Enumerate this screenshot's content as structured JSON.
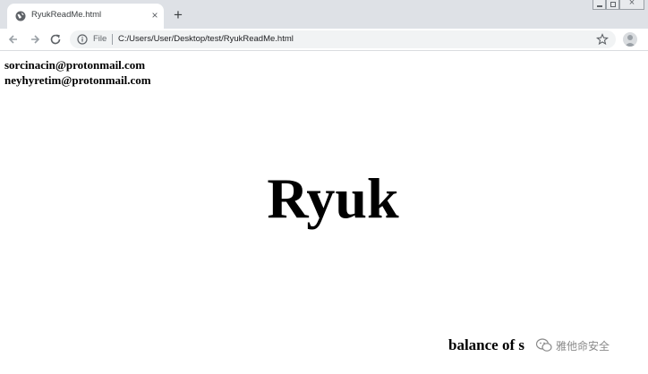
{
  "browser": {
    "tab": {
      "title": "RyukReadMe.html",
      "close_glyph": "×",
      "favicon": "globe-icon"
    },
    "new_tab_glyph": "+",
    "omnibox": {
      "scheme_label": "File",
      "url": "C:/Users/User/Desktop/test/RyukReadMe.html"
    },
    "icons": [
      "back-arrow-icon",
      "forward-arrow-icon",
      "reload-icon",
      "info-icon",
      "star-icon",
      "profile-avatar-icon"
    ]
  },
  "page": {
    "emails": [
      "sorcinacin@protonmail.com",
      "neyhyretim@protonmail.com"
    ],
    "headline": "Ryuk",
    "footer_text": "balance of s"
  },
  "watermark": {
    "text": "雅他命安全"
  },
  "colors": {
    "tabstrip": "#dee1e6",
    "omnibox": "#f1f3f4",
    "text": "#000000"
  }
}
